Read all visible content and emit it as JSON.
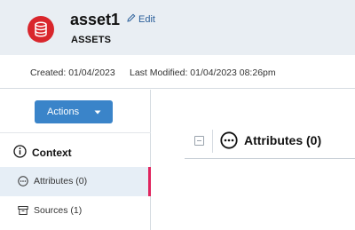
{
  "asset": {
    "name": "asset1",
    "type": "ASSETS",
    "edit_label": "Edit",
    "icon": "database-icon",
    "icon_color": "#d9262c"
  },
  "meta": {
    "created": "Created: 01/04/2023",
    "last_modified": "Last Modified: 01/04/2023 08:26pm"
  },
  "sidebar": {
    "actions_label": "Actions",
    "context_label": "Context",
    "items": [
      {
        "label": "Attributes (0)",
        "icon": "ellipsis-circle-icon",
        "active": true
      },
      {
        "label": "Sources (1)",
        "icon": "archive-box-icon",
        "active": false
      }
    ],
    "active_indicator_color": "#e0245e"
  },
  "main": {
    "section_title": "Attributes (0)"
  },
  "colors": {
    "header_bg": "#e9eef3",
    "primary_button": "#3a84c9",
    "link": "#2b5f9a"
  }
}
